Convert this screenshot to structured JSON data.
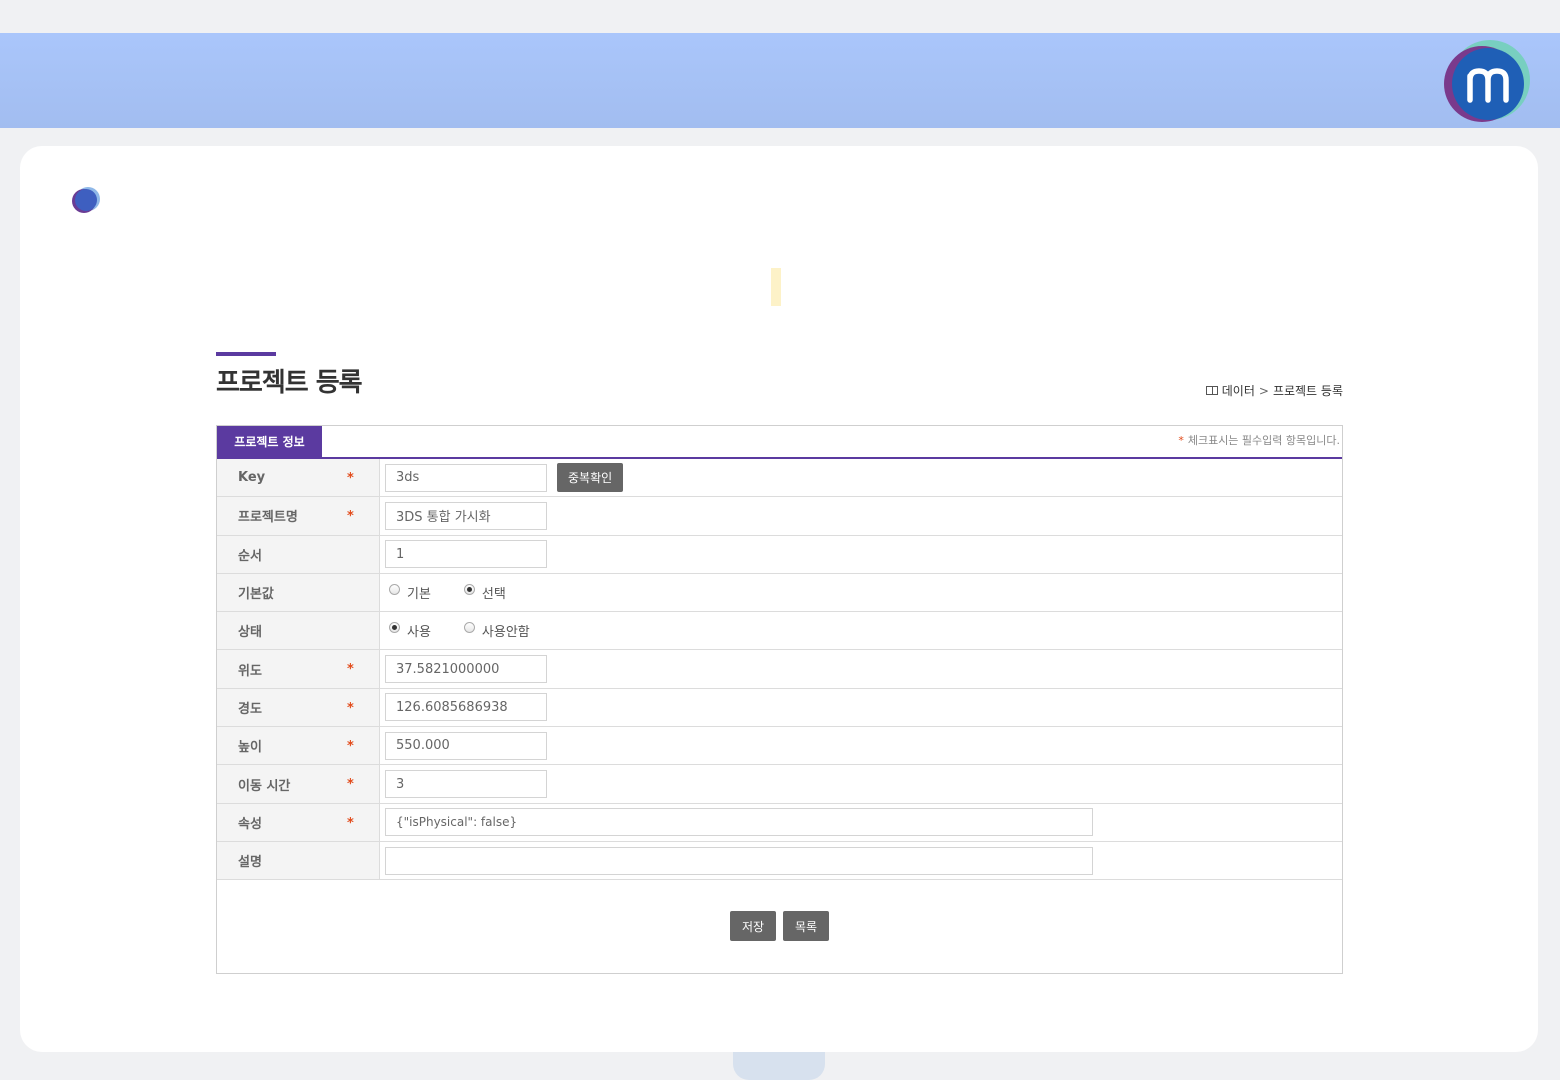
{
  "header": {
    "logo_alt": "m"
  },
  "page": {
    "title": "프로젝트 등록"
  },
  "breadcrumb": {
    "parent": "데이터",
    "separator": ">",
    "current": "프로젝트 등록"
  },
  "form": {
    "tab_label": "프로젝트 정보",
    "required_note": "체크표시는 필수입력 항목입니다.",
    "required_mark": "*",
    "fields": {
      "key": {
        "label": "Key",
        "value": "3ds",
        "button": "중복확인"
      },
      "name": {
        "label": "프로젝트명",
        "value": "3DS 통합 가시화"
      },
      "order": {
        "label": "순서",
        "value": "1"
      },
      "default": {
        "label": "기본값",
        "options": [
          "기본",
          "선택"
        ],
        "selected": "선택"
      },
      "status": {
        "label": "상태",
        "options": [
          "사용",
          "사용안함"
        ],
        "selected": "사용"
      },
      "latitude": {
        "label": "위도",
        "value": "37.5821000000"
      },
      "longitude": {
        "label": "경도",
        "value": "126.6085686938"
      },
      "height": {
        "label": "높이",
        "value": "550.000"
      },
      "move_time": {
        "label": "이동 시간",
        "value": "3"
      },
      "attributes": {
        "label": "속성",
        "value": "{\"isPhysical\": false}"
      },
      "description": {
        "label": "설명",
        "value": ""
      }
    },
    "buttons": {
      "save": "저장",
      "list": "목록"
    }
  },
  "colors": {
    "accent": "#5b3aa0",
    "header": "#a9c4f8",
    "required": "#e24a1a"
  }
}
